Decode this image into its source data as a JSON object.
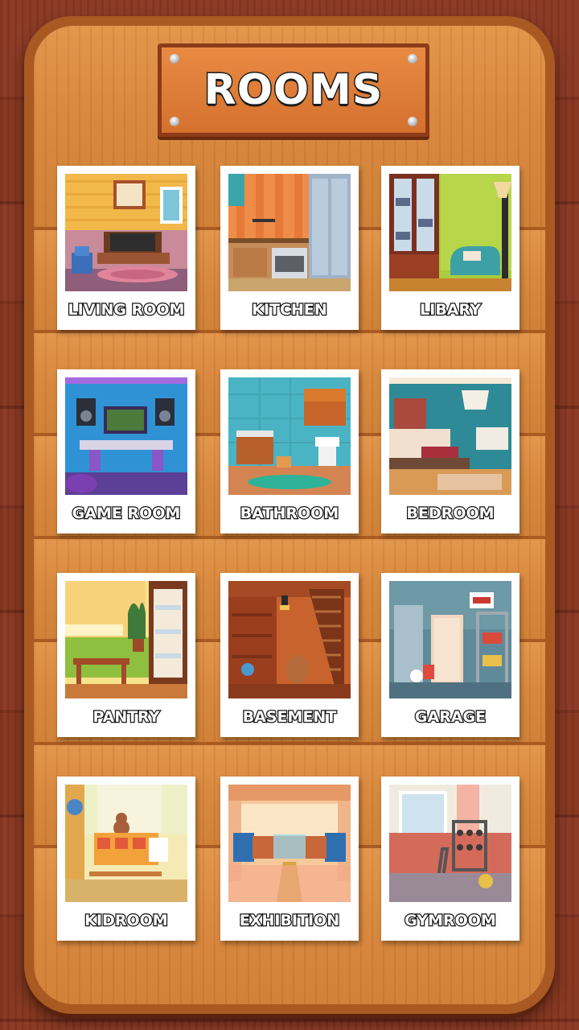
{
  "screen": {
    "title": "ROOMS"
  },
  "rooms": [
    {
      "label": "LIVING ROOM",
      "icon": "living-room-thumbnail"
    },
    {
      "label": "KITCHEN",
      "icon": "kitchen-thumbnail"
    },
    {
      "label": "LIBARY",
      "icon": "library-thumbnail"
    },
    {
      "label": "GAME ROOM",
      "icon": "game-room-thumbnail"
    },
    {
      "label": "BATHROOM",
      "icon": "bathroom-thumbnail"
    },
    {
      "label": "BEDROOM",
      "icon": "bedroom-thumbnail"
    },
    {
      "label": "PANTRY",
      "icon": "pantry-thumbnail"
    },
    {
      "label": "BASEMENT",
      "icon": "basement-thumbnail"
    },
    {
      "label": "GARAGE",
      "icon": "garage-thumbnail"
    },
    {
      "label": "KIDROOM",
      "icon": "kidroom-thumbnail"
    },
    {
      "label": "EXHIBITION",
      "icon": "exhibition-thumbnail"
    },
    {
      "label": "GYMROOM",
      "icon": "gymroom-thumbnail"
    }
  ],
  "colors": {
    "board": "#d88a3e",
    "sign": "#e2803b",
    "background": "#7a2f1e"
  }
}
